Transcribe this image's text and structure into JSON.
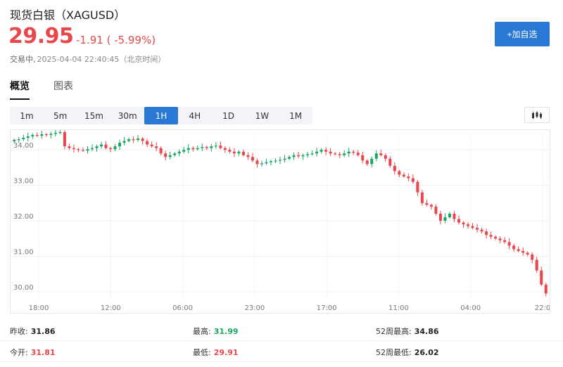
{
  "header": {
    "title": "现货白银（XAGUSD）",
    "price": "29.95",
    "change": "-1.91 ( -5.99%)",
    "status_label": "交易中,",
    "timestamp": "2025-04-04 22:40:45（北京时间）",
    "add_watchlist": "+加自选"
  },
  "tabs": [
    {
      "label": "概览",
      "active": true
    },
    {
      "label": "图表",
      "active": false
    }
  ],
  "periods": [
    "1m",
    "5m",
    "15m",
    "30m",
    "1H",
    "4H",
    "1D",
    "1W",
    "1M"
  ],
  "active_period": "1H",
  "chart_type_icon": "candlestick-icon",
  "colors": {
    "up": "#1aa562",
    "down": "#e8484b",
    "accent": "#2a78d6"
  },
  "chart_data": {
    "type": "candlestick",
    "y_ticks": [
      "34.00",
      "33.00",
      "32.00",
      "31.00",
      "30.00"
    ],
    "ylim": [
      29.8,
      34.4
    ],
    "x_ticks": [
      "18:00",
      "12:00",
      "06:00",
      "23:00",
      "17:00",
      "11:00",
      "04:00",
      "22:0"
    ],
    "grid": true,
    "series_closes": [
      34.28,
      34.3,
      34.34,
      34.38,
      34.42,
      34.4,
      34.44,
      34.42,
      34.45,
      34.48,
      34.5,
      34.1,
      34.05,
      34.02,
      34.0,
      33.98,
      34.02,
      34.05,
      34.1,
      34.15,
      34.05,
      34.02,
      34.1,
      34.2,
      34.25,
      34.3,
      34.28,
      34.32,
      34.25,
      34.15,
      34.1,
      34.05,
      33.9,
      33.8,
      33.85,
      33.9,
      33.95,
      34.0,
      34.05,
      34.02,
      34.05,
      34.08,
      34.05,
      34.1,
      34.12,
      34.05,
      34.0,
      33.95,
      33.9,
      33.95,
      33.85,
      33.8,
      33.7,
      33.6,
      33.62,
      33.65,
      33.68,
      33.7,
      33.72,
      33.75,
      33.8,
      33.85,
      33.82,
      33.85,
      33.88,
      33.9,
      33.95,
      34.0,
      33.95,
      33.9,
      33.88,
      33.85,
      33.9,
      33.95,
      33.92,
      33.85,
      33.7,
      33.6,
      33.75,
      33.9,
      33.85,
      33.75,
      33.55,
      33.4,
      33.3,
      33.25,
      33.2,
      33.1,
      32.8,
      32.5,
      32.45,
      32.4,
      32.2,
      32.0,
      32.1,
      32.2,
      32.05,
      31.95,
      31.9,
      31.85,
      31.8,
      31.75,
      31.7,
      31.6,
      31.55,
      31.5,
      31.45,
      31.4,
      31.3,
      31.2,
      31.15,
      31.1,
      31.05,
      30.9,
      30.6,
      30.2,
      29.95
    ],
    "stats": [
      {
        "label": "昨收:",
        "value": "31.86",
        "tone": "neutral"
      },
      {
        "label": "最高:",
        "value": "31.99",
        "tone": "up"
      },
      {
        "label": "52周最高:",
        "value": "34.86",
        "tone": "neutral"
      },
      {
        "label": "今开:",
        "value": "31.81",
        "tone": "down"
      },
      {
        "label": "最低:",
        "value": "29.91",
        "tone": "down"
      },
      {
        "label": "52周最低:",
        "value": "26.02",
        "tone": "neutral"
      }
    ]
  }
}
